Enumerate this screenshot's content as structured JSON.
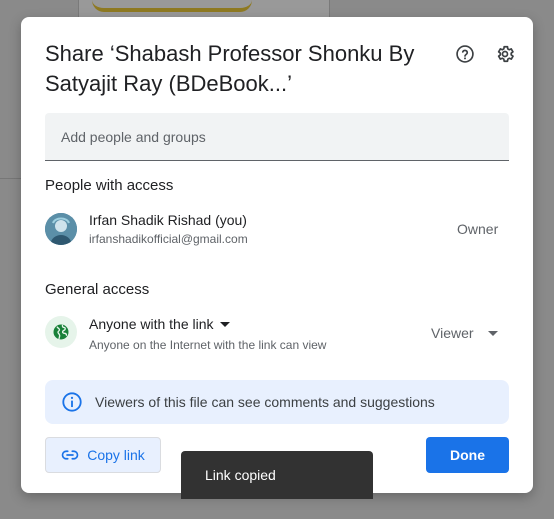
{
  "dialog": {
    "title": "Share ‘Shabash Professor Shonku By Satyajit Ray (BDeBook...’",
    "help_icon": "help-circle-icon",
    "settings_icon": "gear-icon"
  },
  "add_people": {
    "placeholder": "Add people and groups"
  },
  "people_section": {
    "heading": "People with access",
    "users": [
      {
        "name": "Irfan Shadik Rishad (you)",
        "email": "irfanshadikofficial@gmail.com",
        "role": "Owner"
      }
    ]
  },
  "general_access": {
    "heading": "General access",
    "setting": "Anyone with the link",
    "description": "Anyone on the Internet with the link can view",
    "role": "Viewer",
    "icon": "globe-icon",
    "icon_color": "#188038"
  },
  "info": {
    "text": "Viewers of this file can see comments and suggestions",
    "icon": "info-icon"
  },
  "actions": {
    "copy_link": "Copy link",
    "done": "Done"
  },
  "toast": {
    "message": "Link copied"
  },
  "colors": {
    "accent": "#1a73e8",
    "info_bg": "#e8f0fe",
    "overlay": "#8a8a8a"
  }
}
